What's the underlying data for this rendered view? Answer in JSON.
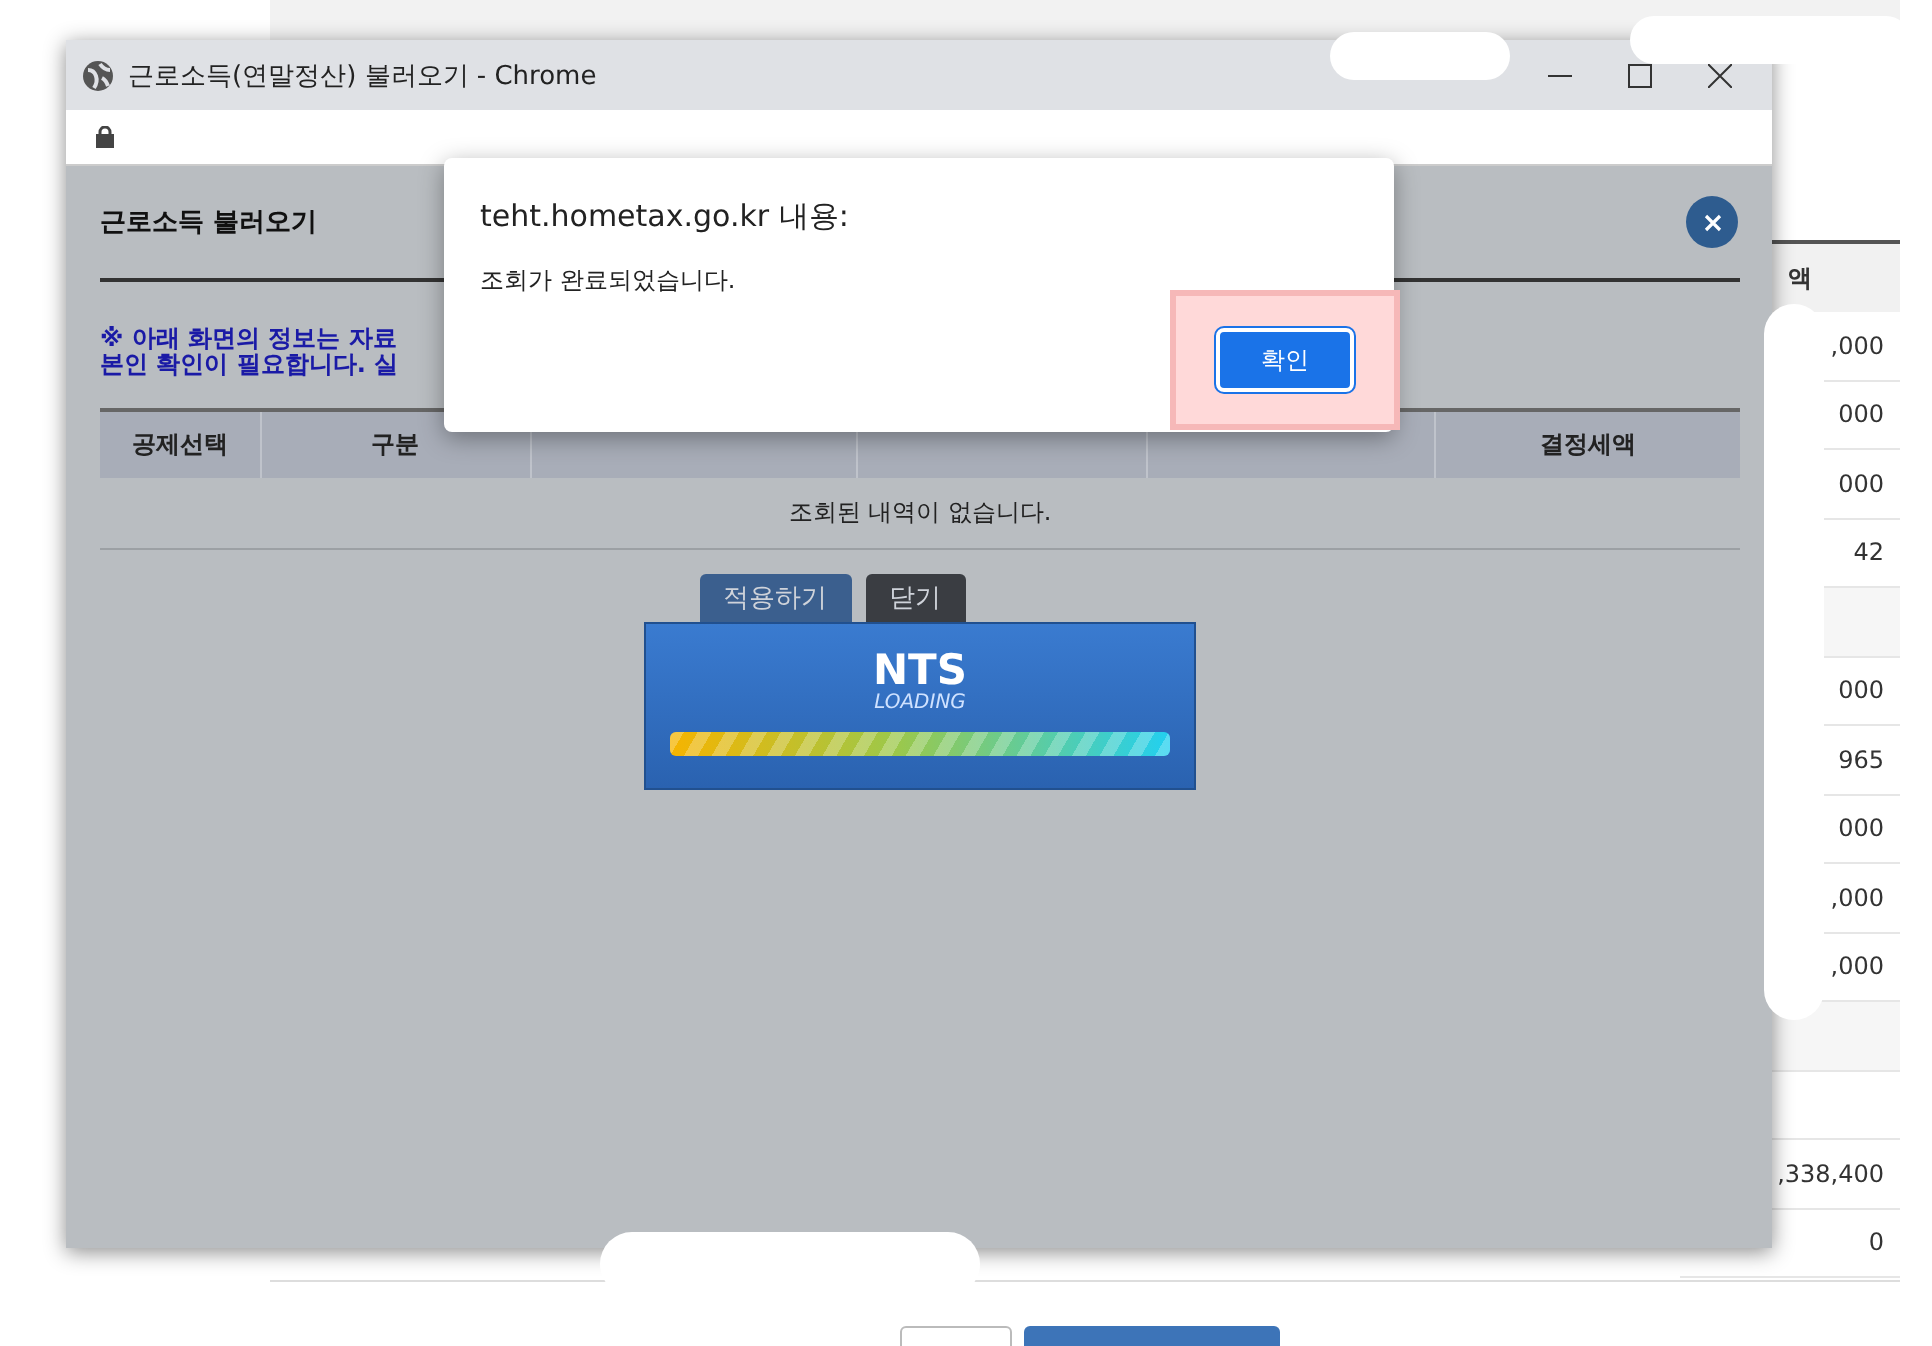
{
  "background_page": {
    "column_header": "액",
    "amounts": [
      ",000",
      "000",
      "000",
      "42",
      "000",
      "965",
      "000",
      ",000",
      ",000",
      ",338,400",
      "0"
    ]
  },
  "popup_window": {
    "title": "근로소득(연말정산) 불러오기 - Chrome",
    "heading": "근로소득 불러오기",
    "notice_lines": [
      "※ 아래 화면의 정보는 자료",
      "본인 확인이 필요합니다. 실"
    ],
    "columns": [
      "공제선택",
      "구분",
      null,
      null,
      null,
      "결정세액"
    ],
    "empty_message": "조회된 내역이 없습니다.",
    "buttons": [
      {
        "label": "적용하기",
        "kind": "primary"
      },
      {
        "label": "닫기",
        "kind": "dark"
      }
    ]
  },
  "loading": {
    "title": "NTS",
    "subtitle": "LOADING",
    "level": 1
  },
  "alert": {
    "origin": "teht.hometax.go.kr 내용:",
    "message": "조회가 완료되었습니다.",
    "button": "확인",
    "highlighted": true
  }
}
